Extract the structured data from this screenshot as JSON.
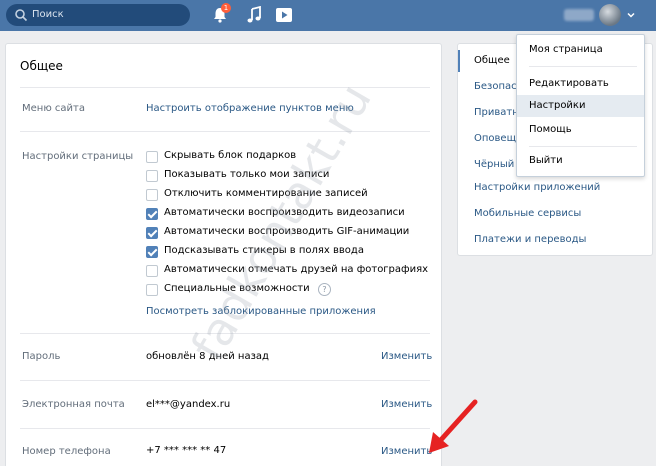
{
  "header": {
    "search_placeholder": "Поиск",
    "notifications_count": "1"
  },
  "panel": {
    "title": "Общее",
    "menu": {
      "label": "Меню сайта",
      "link": "Настроить отображение пунктов меню"
    },
    "page_settings": {
      "label": "Настройки страницы",
      "options": [
        {
          "text": "Скрывать блок подарков",
          "checked": false
        },
        {
          "text": "Показывать только мои записи",
          "checked": false
        },
        {
          "text": "Отключить комментирование записей",
          "checked": false
        },
        {
          "text": "Автоматически воспроизводить видеозаписи",
          "checked": true
        },
        {
          "text": "Автоматически воспроизводить GIF-анимации",
          "checked": true
        },
        {
          "text": "Подсказывать стикеры в полях ввода",
          "checked": true
        },
        {
          "text": "Автоматически отмечать друзей на фотографиях",
          "checked": false
        },
        {
          "text": "Специальные возможности",
          "checked": false
        }
      ],
      "help_mark": "?",
      "blocked_apps_link": "Посмотреть заблокированные приложения"
    },
    "password": {
      "label": "Пароль",
      "value": "обновлён 8 дней назад",
      "action": "Изменить"
    },
    "email": {
      "label": "Электронная почта",
      "value": "el***@yandex.ru",
      "action": "Изменить"
    },
    "phone": {
      "label": "Номер телефона",
      "value": "+7 *** *** ** 47",
      "action": "Изменить"
    }
  },
  "right_menu": {
    "items": [
      "Общее",
      "Безопасность",
      "Приватность",
      "Оповещения",
      "Чёрный список",
      "Настройки приложений",
      "Мобильные сервисы",
      "Платежи и переводы"
    ],
    "active": "Общее"
  },
  "dropdown": {
    "items": [
      "Моя страница",
      "Редактировать",
      "Настройки",
      "Помощь",
      "Выйти"
    ],
    "hovered": "Настройки"
  },
  "watermark": "fadkontakt.ru",
  "colors": {
    "header": "#4a76a8",
    "link": "#2a5885",
    "checkbox_on": "#5181b8",
    "arrow": "#e62222"
  }
}
